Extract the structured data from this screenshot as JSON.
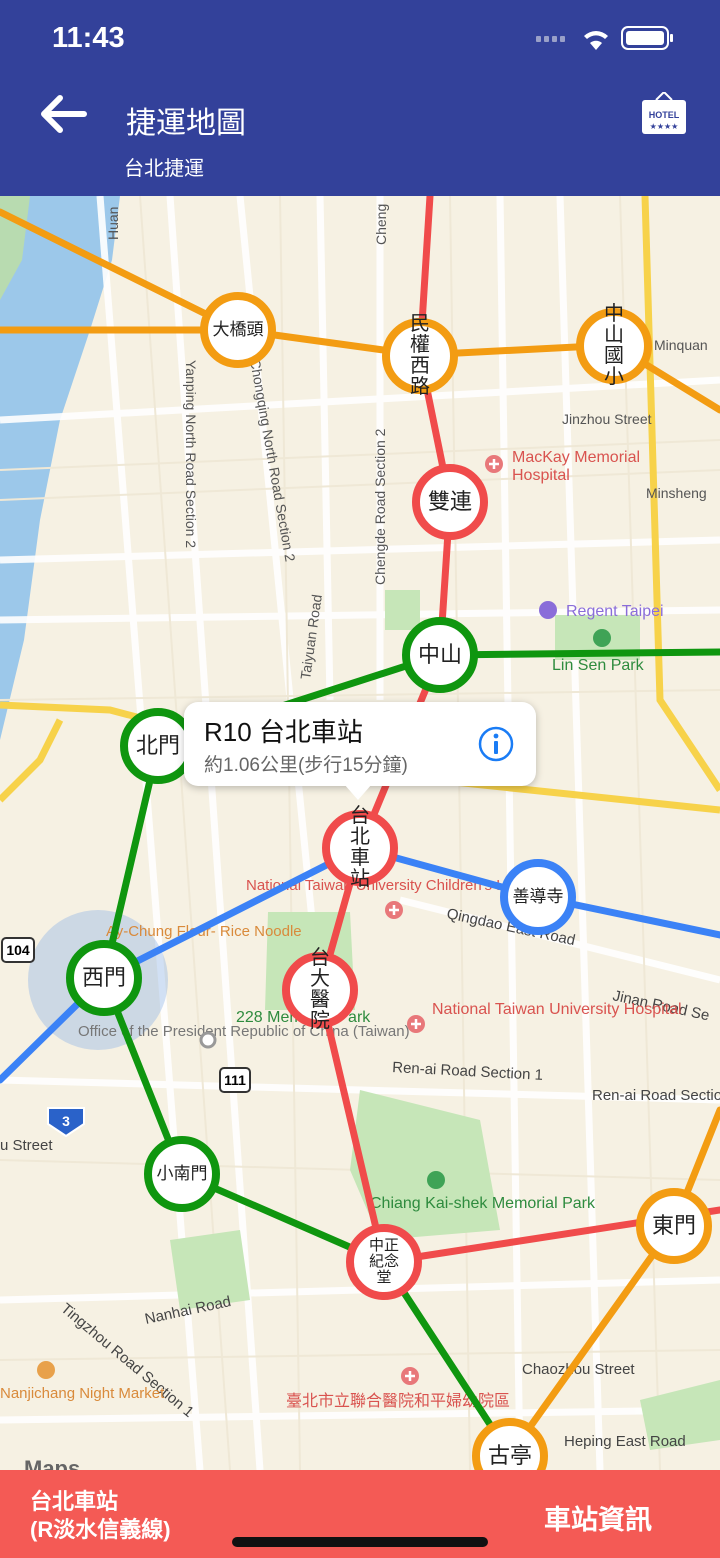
{
  "status_bar": {
    "time": "11:43"
  },
  "header": {
    "title": "捷運地圖",
    "subtitle": "台北捷運"
  },
  "icons": {
    "back": "arrow-left-icon",
    "hotel": "hotel-icon",
    "info": "info-icon",
    "location": "location-arrow-icon"
  },
  "colors": {
    "header": "#33419a",
    "red_line": "#f04b4b",
    "green_line": "#0f960f",
    "orange_line": "#f39c12",
    "blue_line": "#3b82f6",
    "bottom_bar": "#f45a55"
  },
  "stations": {
    "daqiaotou": "大橋頭",
    "minquan": "民權西路",
    "zhongshan_elem": "中山國小",
    "shuanglian": "雙連",
    "zhongshan": "中山",
    "beimen": "北門",
    "taipei_main": "台北車站",
    "shandao": "善導寺",
    "ximen": "西門",
    "ntuh": "台大醫院",
    "xiaonanmen": "小南門",
    "cks": "中正紀念堂",
    "dongmen": "東門",
    "guting": "古亭"
  },
  "callout": {
    "title": "R10 台北車站",
    "subtitle": "約1.06公里(步行15分鐘)"
  },
  "map_labels": {
    "mackay": "MacKay Memorial",
    "hospital": "Hospital",
    "regent": "Regent Taipei",
    "linsen": "Lin Sen Park",
    "jinzhou": "Jinzhou Street",
    "minquan_road": "Minquan",
    "minsheng": "Minsheng",
    "yanping": "Yanping North Road Section 2",
    "chongqing": "Chongqing North Road Section 2",
    "chengde": "Chengde Road Section 2",
    "taiyuan": "Taiyuan Road",
    "ntu_children": "National Taiwan University Children's Hospital",
    "qingdao": "Qingdao East Road",
    "jinan": "Jinan Road Se",
    "ntuh_hosp": "National Taiwan University Hospital",
    "renai": "Ren-ai Road Section 1",
    "renai2": "Ren-ai Road Section",
    "park228": "228 Memorial Park",
    "president": "Office of the President Republic of China (Taiwan)",
    "ayi": "Ay-Chung Flour- Rice Noodle",
    "cks_park": "Chiang Kai-shek Memorial Park",
    "nanhai": "Nanhai Road",
    "tingzhou": "Tingzhou Road Section 1",
    "chaozhou": "Chaozhou Street",
    "heping": "Heping East Road",
    "nanjichang": "Nanjichang Night Market",
    "hosp_city": "臺北市立聯合醫院和平婦幼院區",
    "street": "u Street",
    "maps": "Maps",
    "shield_104": "104",
    "shield_111": "111",
    "shield_3": "3",
    "huan": "Huan",
    "cheng": "Cheng"
  },
  "bottom_bar": {
    "station_name": "台北車站",
    "line_name": "(R淡水信義線)",
    "info_button": "車站資訊"
  }
}
